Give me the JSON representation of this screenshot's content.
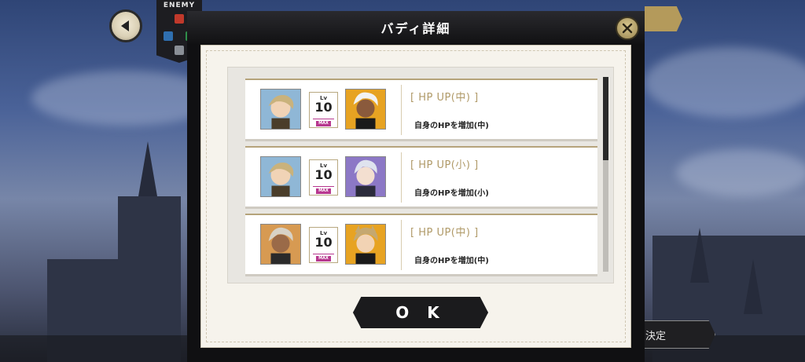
{
  "dialog": {
    "title": "バディ詳細",
    "ok_label": "O K"
  },
  "enemy_panel": {
    "label": "ENEMY"
  },
  "footer": {
    "decide_label": "決定"
  },
  "buddy_list": [
    {
      "level_label": "Lv",
      "level": "10",
      "max_label": "MAX",
      "skill_name": "[ HP UP(中) ]",
      "skill_desc": "自身のHPを増加(中)"
    },
    {
      "level_label": "Lv",
      "level": "10",
      "max_label": "MAX",
      "skill_name": "[ HP UP(小) ]",
      "skill_desc": "自身のHPを増加(小)"
    },
    {
      "level_label": "Lv",
      "level": "10",
      "max_label": "MAX",
      "skill_name": "[ HP UP(中) ]",
      "skill_desc": "自身のHPを増加(中)"
    }
  ],
  "colors": {
    "accent_gold": "#b49a5b",
    "max_magenta": "#b7388f",
    "panel_dark": "#101012"
  }
}
